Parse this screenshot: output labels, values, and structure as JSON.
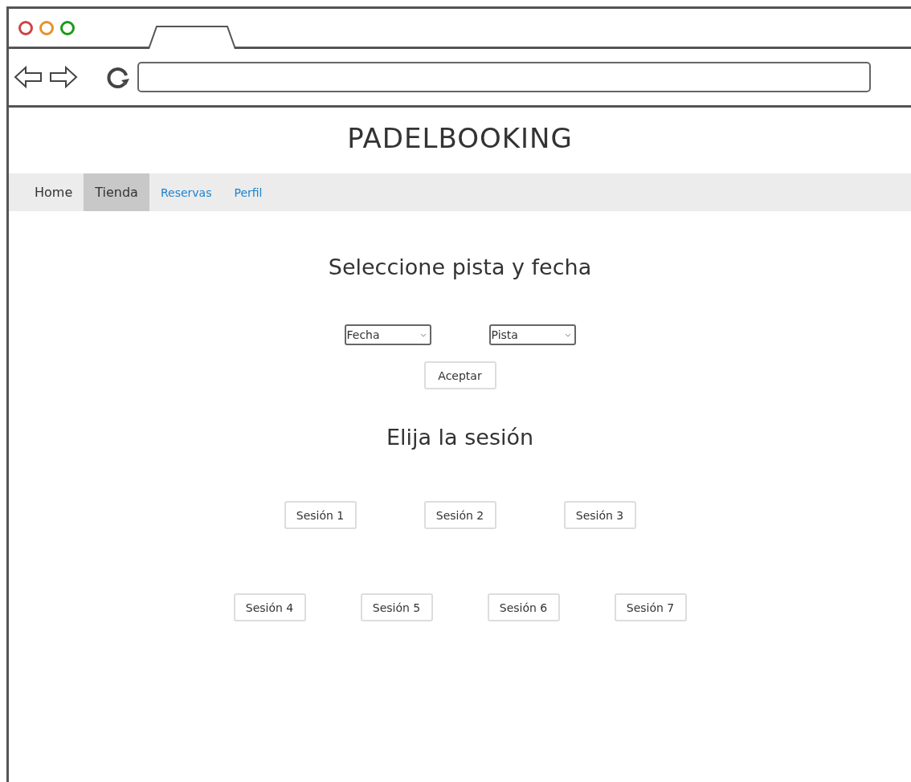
{
  "site_title": "PADELBOOKING",
  "nav": [
    {
      "label": "Home",
      "kind": "plain",
      "selected": false
    },
    {
      "label": "Tienda",
      "kind": "plain",
      "selected": true
    },
    {
      "label": "Reservas",
      "kind": "link",
      "selected": false
    },
    {
      "label": "Perfil",
      "kind": "link",
      "selected": false
    }
  ],
  "heading": "Seleccione pista y fecha",
  "selects": [
    {
      "value": "Fecha"
    },
    {
      "value": "Pista"
    }
  ],
  "accept_button": "Aceptar",
  "session_heading": "Elija la sesión",
  "session_rows": [
    {
      "sessions": [
        "Sesión 1",
        "Sesión 2",
        "Sesión 3"
      ]
    },
    {
      "sessions": [
        "Sesión 4",
        "Sesión 5",
        "Sesión 6",
        "Sesión 7"
      ]
    }
  ]
}
